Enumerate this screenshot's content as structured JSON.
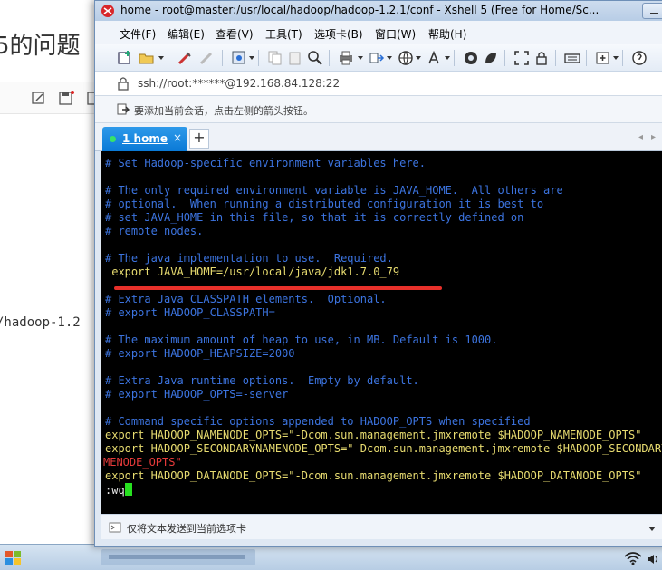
{
  "background_page": {
    "title_fragment": "5的问题",
    "path_fragment": "/hadoop-1.2"
  },
  "window": {
    "title": "home - root@master:/usr/local/hadoop/hadoop-1.2.1/conf - Xshell 5 (Free for Home/Sc..."
  },
  "menu": {
    "items": [
      "文件(F)",
      "编辑(E)",
      "查看(V)",
      "工具(T)",
      "选项卡(B)",
      "窗口(W)",
      "帮助(H)"
    ]
  },
  "toolbar": {
    "icons": [
      "new-session-icon",
      "open-folder-icon",
      "connect-icon",
      "disconnect-icon",
      "properties-icon",
      "copy-icon",
      "paste-icon",
      "find-icon",
      "print-icon",
      "transfer-icon",
      "globe-icon",
      "font-icon",
      "xftp-icon",
      "xmanager-icon",
      "fullscreen-icon",
      "lock-icon",
      "keyboard-icon",
      "new-tab-icon",
      "help-icon"
    ]
  },
  "address": {
    "text": "ssh://root:******@192.168.84.128:22"
  },
  "hint": {
    "text": "要添加当前会话，点击左侧的箭头按钮。"
  },
  "tabs": {
    "active_label": "1 home",
    "close_glyph": "×",
    "new_tab_glyph": "+",
    "prev_glyph": "◂",
    "next_glyph": "▸"
  },
  "terminal": {
    "lines": [
      {
        "text": "# Set Hadoop-specific environment variables here.",
        "style": "comment"
      },
      {
        "text": "",
        "style": "comment"
      },
      {
        "text": "# The only required environment variable is JAVA_HOME.  All others are",
        "style": "comment"
      },
      {
        "text": "# optional.  When running a distributed configuration it is best to",
        "style": "comment"
      },
      {
        "text": "# set JAVA_HOME in this file, so that it is correctly defined on",
        "style": "comment"
      },
      {
        "text": "# remote nodes.",
        "style": "comment"
      },
      {
        "text": "",
        "style": "comment"
      },
      {
        "text": "# The java implementation to use.  Required.",
        "style": "comment"
      },
      {
        "text": " export JAVA_HOME=/usr/local/java/jdk1.7.0_79",
        "style": "export"
      },
      {
        "text": "",
        "style": "comment"
      },
      {
        "text": "# Extra Java CLASSPATH elements.  Optional.",
        "style": "comment"
      },
      {
        "text": "# export HADOOP_CLASSPATH=",
        "style": "comment"
      },
      {
        "text": "",
        "style": "comment"
      },
      {
        "text": "# The maximum amount of heap to use, in MB. Default is 1000.",
        "style": "comment"
      },
      {
        "text": "# export HADOOP_HEAPSIZE=2000",
        "style": "comment"
      },
      {
        "text": "",
        "style": "comment"
      },
      {
        "text": "# Extra Java runtime options.  Empty by default.",
        "style": "comment"
      },
      {
        "text": "# export HADOOP_OPTS=-server",
        "style": "comment"
      },
      {
        "text": "",
        "style": "comment"
      },
      {
        "text": "# Command specific options appended to HADOOP_OPTS when specified",
        "style": "comment"
      },
      {
        "text": "export HADOOP_NAMENODE_OPTS=\"-Dcom.sun.management.jmxremote $HADOOP_NAMENODE_OPTS\"",
        "style": "opts"
      },
      {
        "text": "export HADOOP_SECONDARYNAMENODE_OPTS=\"-Dcom.sun.management.jmxremote $HADOOP_SECONDARYNA",
        "style": "opts"
      },
      {
        "text": "MENODE_OPTS\"",
        "style": "opts"
      },
      {
        "text": "export HADOOP_DATANODE_OPTS=\"-Dcom.sun.management.jmxremote $HADOOP_DATANODE_OPTS\"",
        "style": "opts"
      },
      {
        "text": ":wq",
        "style": "command"
      }
    ]
  },
  "statusbar": {
    "send_text": "仅将文本发送到当前选项卡"
  },
  "colors": {
    "comment": "#3c74e0",
    "keyword": "#e8dc70",
    "string": "#e83b3b",
    "cursor": "#27e020",
    "tab_active": "#0a79d6",
    "underline": "#e8302a"
  }
}
